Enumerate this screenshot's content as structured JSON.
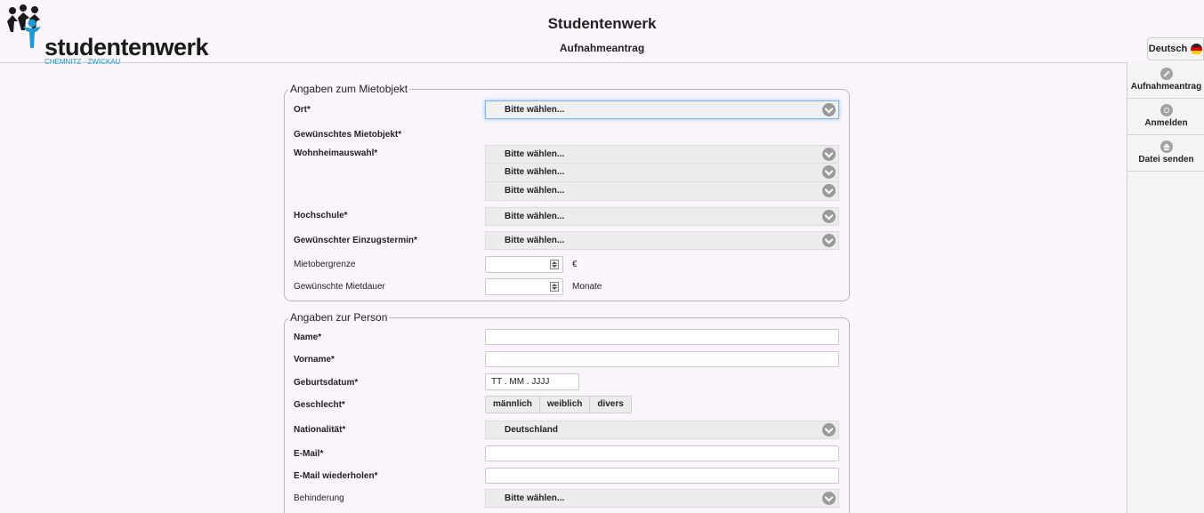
{
  "header": {
    "logo_text": "studentenwerk",
    "logo_sub": "CHEMNITZ · ZWICKAU",
    "title": "Studentenwerk",
    "subtitle": "Aufnahmeantrag",
    "language_label": "Deutsch"
  },
  "nav": {
    "items": [
      {
        "label": "Aufnahmeantrag",
        "icon": "pencil-icon"
      },
      {
        "label": "Anmelden",
        "icon": "gear-icon"
      },
      {
        "label": "Datei senden",
        "icon": "upload-icon"
      }
    ]
  },
  "colors": {
    "accent_blue": "#1e9ad6",
    "page_bg": "#f9f5fa"
  },
  "mietobjekt": {
    "legend": "Angaben zum Mietobjekt",
    "ort_label": "Ort*",
    "ort_value": "Bitte wählen...",
    "gewuenscht_label": "Gewünschtes Mietobjekt*",
    "wohnheim_label": "Wohnheimauswahl*",
    "wohnheim_values": [
      "Bitte wählen...",
      "Bitte wählen...",
      "Bitte wählen..."
    ],
    "hochschule_label": "Hochschule*",
    "hochschule_value": "Bitte wählen...",
    "einzug_label": "Gewünschter Einzugstermin*",
    "einzug_value": "Bitte wählen...",
    "miete_label": "Mietobergrenze",
    "miete_unit": "€",
    "dauer_label": "Gewünschte Mietdauer",
    "dauer_unit": "Monate"
  },
  "person": {
    "legend": "Angaben zur Person",
    "name_label": "Name*",
    "vorname_label": "Vorname*",
    "geburt_label": "Geburtsdatum*",
    "geburt_placeholder": "TT . MM . JJJJ",
    "geschlecht_label": "Geschlecht*",
    "geschlecht_options": [
      "männlich",
      "weiblich",
      "divers"
    ],
    "nation_label": "Nationalität*",
    "nation_value": "Deutschland",
    "email_label": "E-Mail*",
    "email2_label": "E-Mail wiederholen*",
    "behinderung_label": "Behinderung",
    "behinderung_value": "Bitte wählen..."
  }
}
